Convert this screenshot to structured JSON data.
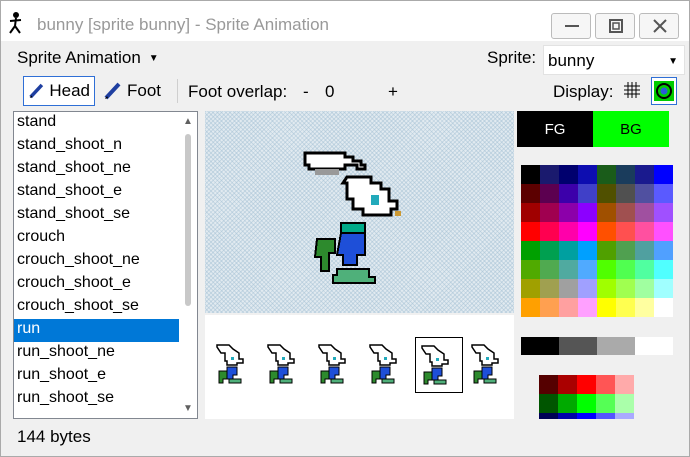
{
  "window": {
    "title": "bunny [sprite bunny] - Sprite Animation",
    "accent": "#0078d7",
    "buttons": [
      "minimize-icon",
      "maximize-icon",
      "close-icon"
    ]
  },
  "menubar": {
    "menu_label": "Sprite Animation",
    "sprite_label": "Sprite:",
    "sprite_value": "bunny"
  },
  "toolbar": {
    "head_label": "Head",
    "foot_label": "Foot",
    "overlap_label": "Foot overlap:",
    "minus_label": "-",
    "overlap_value": "0",
    "plus_label": "+",
    "display_label": "Display:",
    "active_tool": "Head"
  },
  "animations": {
    "items": [
      "stand",
      "stand_shoot_n",
      "stand_shoot_ne",
      "stand_shoot_e",
      "stand_shoot_se",
      "crouch",
      "crouch_shoot_ne",
      "crouch_shoot_e",
      "crouch_shoot_se",
      "run",
      "run_shoot_ne",
      "run_shoot_e",
      "run_shoot_se"
    ],
    "selected": "run",
    "scroll_position": 0.0
  },
  "frames": {
    "count": 6,
    "selected_index": 4
  },
  "colors": {
    "fg_label": "FG",
    "bg_label": "BG",
    "fg_color": "#000000",
    "bg_color": "#00ff00",
    "palette": [
      "#000000",
      "#1a1a6e",
      "#00006e",
      "#0d0db0",
      "#1a5c1a",
      "#1a3c5c",
      "#1a1a8e",
      "#0000ff",
      "#5c0000",
      "#5c0050",
      "#3c00aa",
      "#4040c8",
      "#505000",
      "#505050",
      "#5050a0",
      "#5a5aff",
      "#a00000",
      "#a00050",
      "#8c00aa",
      "#8c00ff",
      "#a05000",
      "#a05050",
      "#a050a0",
      "#a050ff",
      "#ff0000",
      "#ff0050",
      "#ff00aa",
      "#ff00ff",
      "#ff5000",
      "#ff5050",
      "#ff50a0",
      "#ff50ff",
      "#00a000",
      "#00a050",
      "#00a0a0",
      "#00a0ff",
      "#50a000",
      "#50a050",
      "#50a0a0",
      "#50a0ff",
      "#50aa00",
      "#50aa50",
      "#50aaa0",
      "#50aaff",
      "#50ff00",
      "#50ff50",
      "#50ffa0",
      "#50ffff",
      "#a0a000",
      "#a0a050",
      "#a0a0a0",
      "#a0a0ff",
      "#a0ff00",
      "#a0ff50",
      "#a0ffa0",
      "#a0ffff",
      "#ffa000",
      "#ffa050",
      "#ffa0a0",
      "#ffa0ff",
      "#ffff00",
      "#ffff50",
      "#ffffa0",
      "#ffffff"
    ],
    "grays": [
      "#000000",
      "#555555",
      "#aaaaaa",
      "#ffffff"
    ],
    "custom": [
      "#550000",
      "#aa0000",
      "#ff0000",
      "#ff5555",
      "#ffaaaa",
      "#005500",
      "#00aa00",
      "#00ff00",
      "#55ff55",
      "#aaffaa",
      "#000055",
      "#0000aa",
      "#0000ff",
      "#5555ff",
      "#aaaaff"
    ]
  },
  "status": {
    "text": "144 bytes"
  }
}
